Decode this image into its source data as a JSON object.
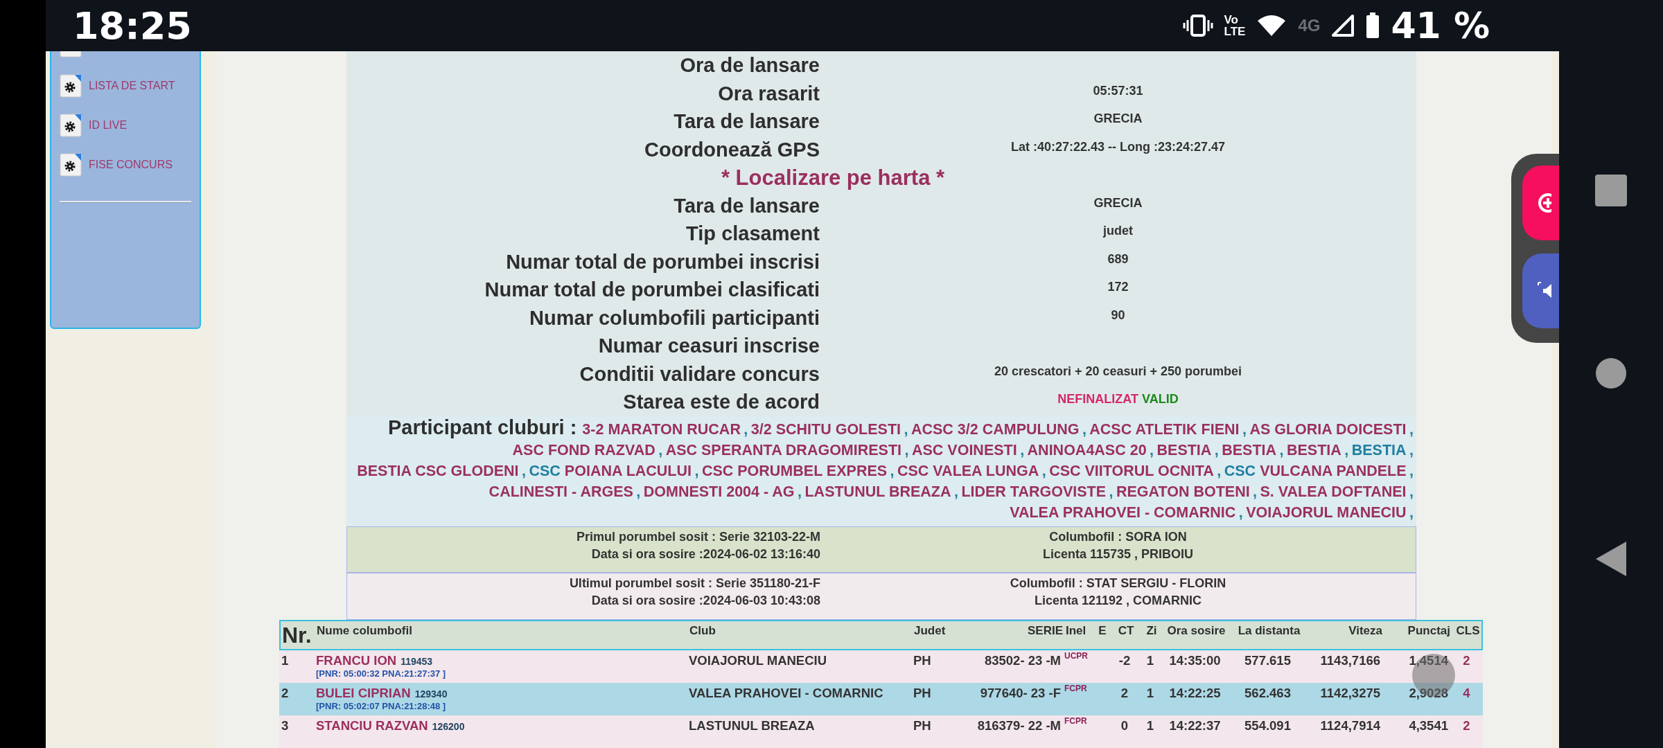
{
  "status_bar": {
    "time": "18:25",
    "volte": [
      "Vo",
      "LTE"
    ],
    "network": "4G",
    "battery_percent": "41 %"
  },
  "sidebar": {
    "items": [
      {
        "label": "LISTA DE START"
      },
      {
        "label": "ID LIVE"
      },
      {
        "label": "FISE CONCURS"
      }
    ]
  },
  "details": [
    {
      "kind": "field",
      "label": "Ora de lansare"
    },
    {
      "kind": "field",
      "label": "Ora rasarit",
      "value": "05:57:31"
    },
    {
      "kind": "field",
      "label": "Tara de lansare",
      "value": "GRECIA"
    },
    {
      "kind": "field",
      "label": "Coordonează GPS",
      "value": "Lat :40:27:22.43 -- Long :23:24:27.47"
    },
    {
      "kind": "link",
      "label": "* Localizare pe harta *"
    },
    {
      "kind": "field",
      "label": "Tara de lansare",
      "value": "GRECIA"
    },
    {
      "kind": "field",
      "label": "Tip clasament",
      "value": "judet"
    },
    {
      "kind": "field",
      "label": "Numar total de porumbei inscrisi",
      "value": "689"
    },
    {
      "kind": "field",
      "label": "Numar total de porumbei clasificati",
      "value": "172"
    },
    {
      "kind": "field",
      "label": "Numar columbofili participanti",
      "value": "90"
    },
    {
      "kind": "field",
      "label": "Numar ceasuri inscrise"
    },
    {
      "kind": "field",
      "label": "Conditii validare concurs",
      "value": "20 crescatori + 20 ceasuri + 250 porumbei"
    },
    {
      "kind": "status",
      "label": "Starea este de acord",
      "states": [
        {
          "text": "NEFINALIZAT",
          "kind": "pending"
        },
        {
          "text": "VALID",
          "kind": "valid"
        }
      ]
    }
  ],
  "clubs": {
    "label": "Participant cluburi :",
    "separator": ",",
    "items": [
      {
        "text": "3-2 MARATON RUCAR",
        "color": "#9b2f5e"
      },
      {
        "text": "3/2 SCHITU GOLESTI",
        "color": "#9b2f5e"
      },
      {
        "text": "ACSC 3/2 CAMPULUNG",
        "color": "#9b2f5e"
      },
      {
        "text": "ACSC ATLETIK FIENI",
        "color": "#9b2f5e"
      },
      {
        "text": "AS GLORIA DOICESTI",
        "color": "#9b2f5e"
      },
      {
        "text": "ASC FOND RAZVAD",
        "color": "#9b2f5e"
      },
      {
        "text": "ASC SPERANTA DRAGOMIRESTI",
        "color": "#9b2f5e"
      },
      {
        "text": "ASC VOINESTI",
        "color": "#9b2f5e"
      },
      {
        "text": "ANINOA4ASC 20",
        "color": "#9b2f5e"
      },
      {
        "text": "BESTIA",
        "color": "#9b2f5e"
      },
      {
        "text": "BESTIA",
        "color": "#9b2f5e"
      },
      {
        "text": "BESTIA",
        "color": "#9b2f5e"
      },
      {
        "text": "BESTIA",
        "color": "#1f7fa0"
      },
      {
        "text": "BESTIA CSC GLODENI",
        "color": "#9b2f5e"
      },
      {
        "prefix": {
          "text": "CSC",
          "color": "#1f7fa0"
        },
        "text": "POIANA LACULUI",
        "color": "#9b2f5e"
      },
      {
        "text": "CSC PORUMBEL EXPRES",
        "color": "#9b2f5e"
      },
      {
        "text": "CSC VALEA LUNGA",
        "color": "#9b2f5e"
      },
      {
        "text": "CSC VIITORUL OCNITA",
        "color": "#9b2f5e"
      },
      {
        "prefix": {
          "text": "CSC",
          "color": "#1f7fa0"
        },
        "text": "VULCANA PANDELE",
        "color": "#9b2f5e"
      },
      {
        "text": "CALINESTI - ARGES",
        "color": "#9b2f5e"
      },
      {
        "text": "DOMNESTI 2004 - AG",
        "color": "#9b2f5e"
      },
      {
        "text": "LASTUNUL BREAZA",
        "color": "#9b2f5e"
      },
      {
        "text": "LIDER TARGOVISTE",
        "color": "#9b2f5e"
      },
      {
        "text": "REGATON BOTENI",
        "color": "#9b2f5e"
      },
      {
        "text": "S. VALEA DOFTANEI",
        "color": "#9b2f5e"
      },
      {
        "text": "VALEA PRAHOVEI - COMARNIC",
        "color": "#9b2f5e"
      },
      {
        "text": "VOIAJORUL MANECIU",
        "color": "#9b2f5e"
      }
    ]
  },
  "arrivals": [
    {
      "kind": "first",
      "left": [
        "Primul porumbel sosit : Serie 32103-22-M",
        "Data si ora sosire :2024-06-02 13:16:40"
      ],
      "right": [
        "Columbofil : SORA ION",
        "Licenta 115735 , PRIBOIU"
      ]
    },
    {
      "kind": "last",
      "left": [
        "Ultimul porumbel sosit : Serie 351180-21-F",
        "Data si ora sosire :2024-06-03 10:43:08"
      ],
      "right": [
        "Columbofil : STAT SERGIU - FLORIN",
        "Licenta 121192 , COMARNIC"
      ]
    }
  ],
  "results": {
    "columns": [
      "Nr.",
      "Nume columbofil",
      "Club",
      "Judet",
      "SERIE",
      "Inel",
      "E",
      "CT",
      "Zi",
      "Ora sosire",
      "La distanta",
      "Viteza",
      "Punctaj",
      "CLS"
    ],
    "rows": [
      {
        "nr": "1",
        "name": "FRANCU ION",
        "license": "119453",
        "pnr": "[PNR: 05:00:32 PNA:21:27:37 ]",
        "club": "VOIAJORUL MANECIU",
        "judet": "PH",
        "serie": "83502- 23 -M",
        "inel": "UCPR",
        "ct": "-2",
        "zi": "1",
        "ora": "14:35:00",
        "distanta": "577.615",
        "viteza": "1143,7166",
        "punctaj": "1,4514",
        "cls": "2"
      },
      {
        "nr": "2",
        "name": "BULEI CIPRIAN",
        "license": "129340",
        "pnr": "[PNR: 05:02:07 PNA:21:28:48 ]",
        "club": "VALEA PRAHOVEI - COMARNIC",
        "judet": "PH",
        "serie": "977640- 23 -F",
        "inel": "FCPR",
        "ct": "2",
        "zi": "1",
        "ora": "14:22:25",
        "distanta": "562.463",
        "viteza": "1142,3275",
        "punctaj": "2,9028",
        "cls": "4"
      },
      {
        "nr": "3",
        "name": "STANCIU RAZVAN",
        "license": "126200",
        "club": "LASTUNUL BREAZA",
        "judet": "PH",
        "serie": "816379- 22 -M",
        "inel": "FCPR",
        "ct": "0",
        "zi": "1",
        "ora": "14:22:37",
        "distanta": "554.091",
        "viteza": "1124,7914",
        "punctaj": "4,3541",
        "cls": "2"
      }
    ]
  }
}
